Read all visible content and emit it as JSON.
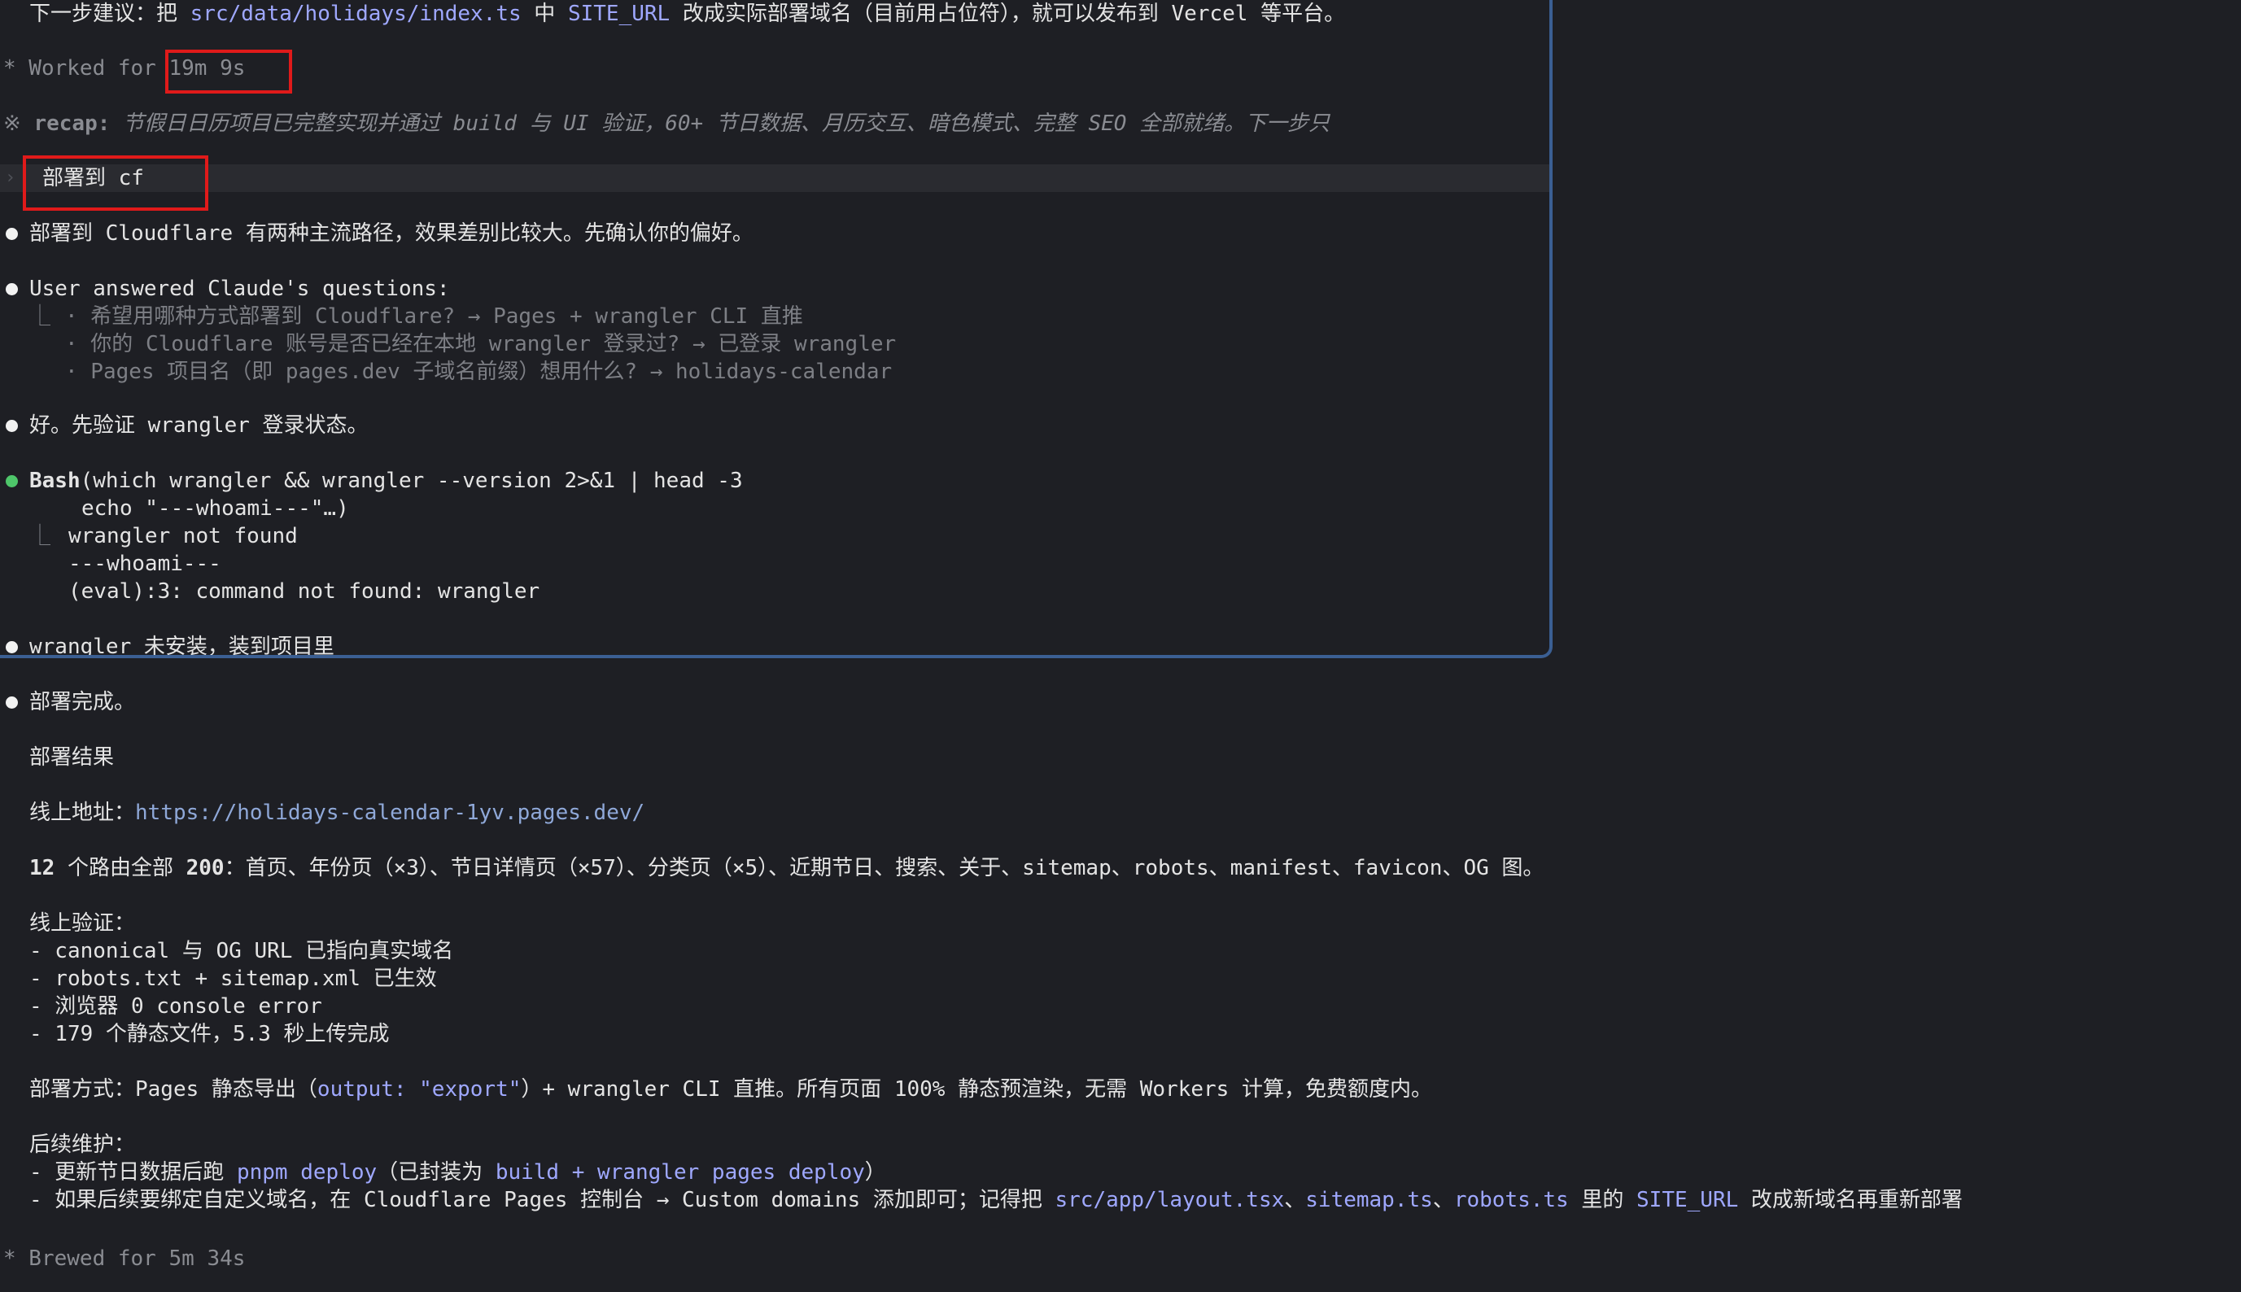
{
  "panel": {
    "next_step": {
      "t1": "下一步建议：把 ",
      "c1": "src/data/holidays/index.ts",
      "t2": " 中 ",
      "c2": "SITE_URL",
      "t3": " 改成实际部署域名（目前用占位符），就可以发布到 Vercel 等平台。"
    },
    "worked": {
      "prefix": "* Worked for ",
      "time": "19m 9s"
    },
    "recap": {
      "mark": "※ ",
      "label": "recap:",
      "text": " 节假日日历项目已完整实现并通过 build 与 UI 验证，60+ 节日数据、月历交互、暗色模式、完整 SEO 全部就绪。下一步只"
    },
    "prompt": {
      "caret": "›",
      "text": "部署到 cf"
    },
    "msg1": "部署到 Cloudflare 有两种主流路径，效果差别比较大。先确认你的偏好。",
    "answers": {
      "header": "User answered Claude's questions:",
      "corner": "⎿",
      "items": [
        "· 希望用哪种方式部署到 Cloudflare? → Pages + wrangler CLI 直推",
        "· 你的 Cloudflare 账号是否已经在本地 wrangler 登录过? → 已登录 wrangler",
        "· Pages 项目名（即 pages.dev 子域名前缀）想用什么? → holidays-calendar"
      ]
    },
    "msg2": "好。先验证 wrangler 登录状态。",
    "bash": {
      "name": "Bash",
      "cmd": "(which wrangler && wrangler --version 2>&1 | head -3",
      "cmd2": "echo \"---whoami---\"…)",
      "corner": "⎿",
      "out": [
        "wrangler not found",
        "---whoami---",
        "(eval):3: command not found: wrangler"
      ]
    },
    "msg3": "wrangler 未安装，装到项目里"
  },
  "main": {
    "done": "部署完成。",
    "result_title": "部署结果",
    "url_label": "线上地址：",
    "url": "https://holidays-calendar-1yv.pages.dev/",
    "routes": {
      "b1": "12",
      "t1": " 个路由全部 ",
      "b2": "200",
      "t2": "：首页、年份页（×3）、节日详情页（×57）、分类页（×5）、近期节日、搜索、关于、sitemap、robots、manifest、favicon、OG 图。"
    },
    "verify_title": "线上验证：",
    "verify": [
      "- canonical 与 OG URL 已指向真实域名",
      "- robots.txt + sitemap.xml 已生效",
      "- 浏览器 0 console error",
      "- 179 个静态文件，5.3 秒上传完成"
    ],
    "deploy_method": {
      "t1": "部署方式：Pages 静态导出（",
      "c1": "output: \"export\"",
      "t2": "）+ wrangler CLI 直推。所有页面 100% 静态预渲染，无需 Workers 计算，免费额度内。"
    },
    "maint_title": "后续维护：",
    "maint1": {
      "t1": "- 更新节日数据后跑 ",
      "c1": "pnpm deploy",
      "t2": "（已封装为 ",
      "c2": "build + wrangler pages deploy",
      "t3": "）"
    },
    "maint2": {
      "t1": "- 如果后续要绑定自定义域名，在 Cloudflare Pages 控制台 → Custom domains 添加即可；记得把 ",
      "c1": "src/app/layout.tsx",
      "s1": "、",
      "c2": "sitemap.ts",
      "s2": "、",
      "c3": "robots.ts",
      "t2": " 里的 ",
      "c4": "SITE_URL",
      "t3": " 改成新域名再重新部署"
    },
    "brewed": "* Brewed for 5m 34s"
  },
  "colors": {
    "accent_code": "#9fa8ff",
    "highlight_box": "#e01a1a",
    "panel_border": "#3b5f93",
    "success_dot": "#4ec66a"
  }
}
